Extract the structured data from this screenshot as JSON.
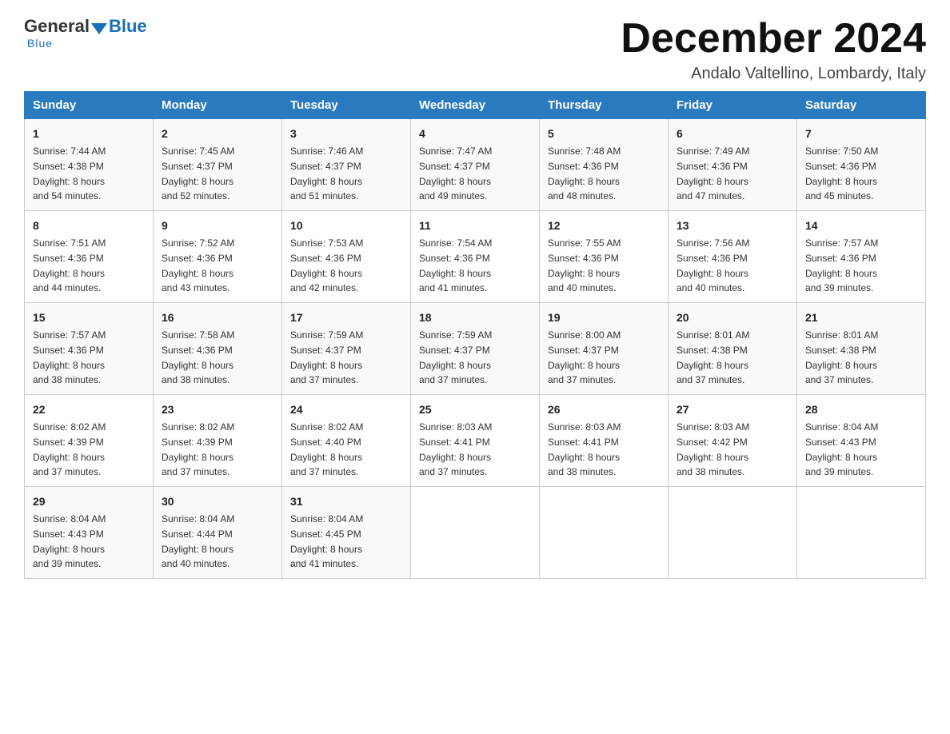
{
  "header": {
    "logo_general": "General",
    "logo_blue": "Blue",
    "month_title": "December 2024",
    "location": "Andalo Valtellino, Lombardy, Italy"
  },
  "days_of_week": [
    "Sunday",
    "Monday",
    "Tuesday",
    "Wednesday",
    "Thursday",
    "Friday",
    "Saturday"
  ],
  "weeks": [
    [
      {
        "day": "1",
        "sunrise": "7:44 AM",
        "sunset": "4:38 PM",
        "daylight": "8 hours and 54 minutes."
      },
      {
        "day": "2",
        "sunrise": "7:45 AM",
        "sunset": "4:37 PM",
        "daylight": "8 hours and 52 minutes."
      },
      {
        "day": "3",
        "sunrise": "7:46 AM",
        "sunset": "4:37 PM",
        "daylight": "8 hours and 51 minutes."
      },
      {
        "day": "4",
        "sunrise": "7:47 AM",
        "sunset": "4:37 PM",
        "daylight": "8 hours and 49 minutes."
      },
      {
        "day": "5",
        "sunrise": "7:48 AM",
        "sunset": "4:36 PM",
        "daylight": "8 hours and 48 minutes."
      },
      {
        "day": "6",
        "sunrise": "7:49 AM",
        "sunset": "4:36 PM",
        "daylight": "8 hours and 47 minutes."
      },
      {
        "day": "7",
        "sunrise": "7:50 AM",
        "sunset": "4:36 PM",
        "daylight": "8 hours and 45 minutes."
      }
    ],
    [
      {
        "day": "8",
        "sunrise": "7:51 AM",
        "sunset": "4:36 PM",
        "daylight": "8 hours and 44 minutes."
      },
      {
        "day": "9",
        "sunrise": "7:52 AM",
        "sunset": "4:36 PM",
        "daylight": "8 hours and 43 minutes."
      },
      {
        "day": "10",
        "sunrise": "7:53 AM",
        "sunset": "4:36 PM",
        "daylight": "8 hours and 42 minutes."
      },
      {
        "day": "11",
        "sunrise": "7:54 AM",
        "sunset": "4:36 PM",
        "daylight": "8 hours and 41 minutes."
      },
      {
        "day": "12",
        "sunrise": "7:55 AM",
        "sunset": "4:36 PM",
        "daylight": "8 hours and 40 minutes."
      },
      {
        "day": "13",
        "sunrise": "7:56 AM",
        "sunset": "4:36 PM",
        "daylight": "8 hours and 40 minutes."
      },
      {
        "day": "14",
        "sunrise": "7:57 AM",
        "sunset": "4:36 PM",
        "daylight": "8 hours and 39 minutes."
      }
    ],
    [
      {
        "day": "15",
        "sunrise": "7:57 AM",
        "sunset": "4:36 PM",
        "daylight": "8 hours and 38 minutes."
      },
      {
        "day": "16",
        "sunrise": "7:58 AM",
        "sunset": "4:36 PM",
        "daylight": "8 hours and 38 minutes."
      },
      {
        "day": "17",
        "sunrise": "7:59 AM",
        "sunset": "4:37 PM",
        "daylight": "8 hours and 37 minutes."
      },
      {
        "day": "18",
        "sunrise": "7:59 AM",
        "sunset": "4:37 PM",
        "daylight": "8 hours and 37 minutes."
      },
      {
        "day": "19",
        "sunrise": "8:00 AM",
        "sunset": "4:37 PM",
        "daylight": "8 hours and 37 minutes."
      },
      {
        "day": "20",
        "sunrise": "8:01 AM",
        "sunset": "4:38 PM",
        "daylight": "8 hours and 37 minutes."
      },
      {
        "day": "21",
        "sunrise": "8:01 AM",
        "sunset": "4:38 PM",
        "daylight": "8 hours and 37 minutes."
      }
    ],
    [
      {
        "day": "22",
        "sunrise": "8:02 AM",
        "sunset": "4:39 PM",
        "daylight": "8 hours and 37 minutes."
      },
      {
        "day": "23",
        "sunrise": "8:02 AM",
        "sunset": "4:39 PM",
        "daylight": "8 hours and 37 minutes."
      },
      {
        "day": "24",
        "sunrise": "8:02 AM",
        "sunset": "4:40 PM",
        "daylight": "8 hours and 37 minutes."
      },
      {
        "day": "25",
        "sunrise": "8:03 AM",
        "sunset": "4:41 PM",
        "daylight": "8 hours and 37 minutes."
      },
      {
        "day": "26",
        "sunrise": "8:03 AM",
        "sunset": "4:41 PM",
        "daylight": "8 hours and 38 minutes."
      },
      {
        "day": "27",
        "sunrise": "8:03 AM",
        "sunset": "4:42 PM",
        "daylight": "8 hours and 38 minutes."
      },
      {
        "day": "28",
        "sunrise": "8:04 AM",
        "sunset": "4:43 PM",
        "daylight": "8 hours and 39 minutes."
      }
    ],
    [
      {
        "day": "29",
        "sunrise": "8:04 AM",
        "sunset": "4:43 PM",
        "daylight": "8 hours and 39 minutes."
      },
      {
        "day": "30",
        "sunrise": "8:04 AM",
        "sunset": "4:44 PM",
        "daylight": "8 hours and 40 minutes."
      },
      {
        "day": "31",
        "sunrise": "8:04 AM",
        "sunset": "4:45 PM",
        "daylight": "8 hours and 41 minutes."
      },
      null,
      null,
      null,
      null
    ]
  ],
  "labels": {
    "sunrise": "Sunrise:",
    "sunset": "Sunset:",
    "daylight": "Daylight:"
  }
}
